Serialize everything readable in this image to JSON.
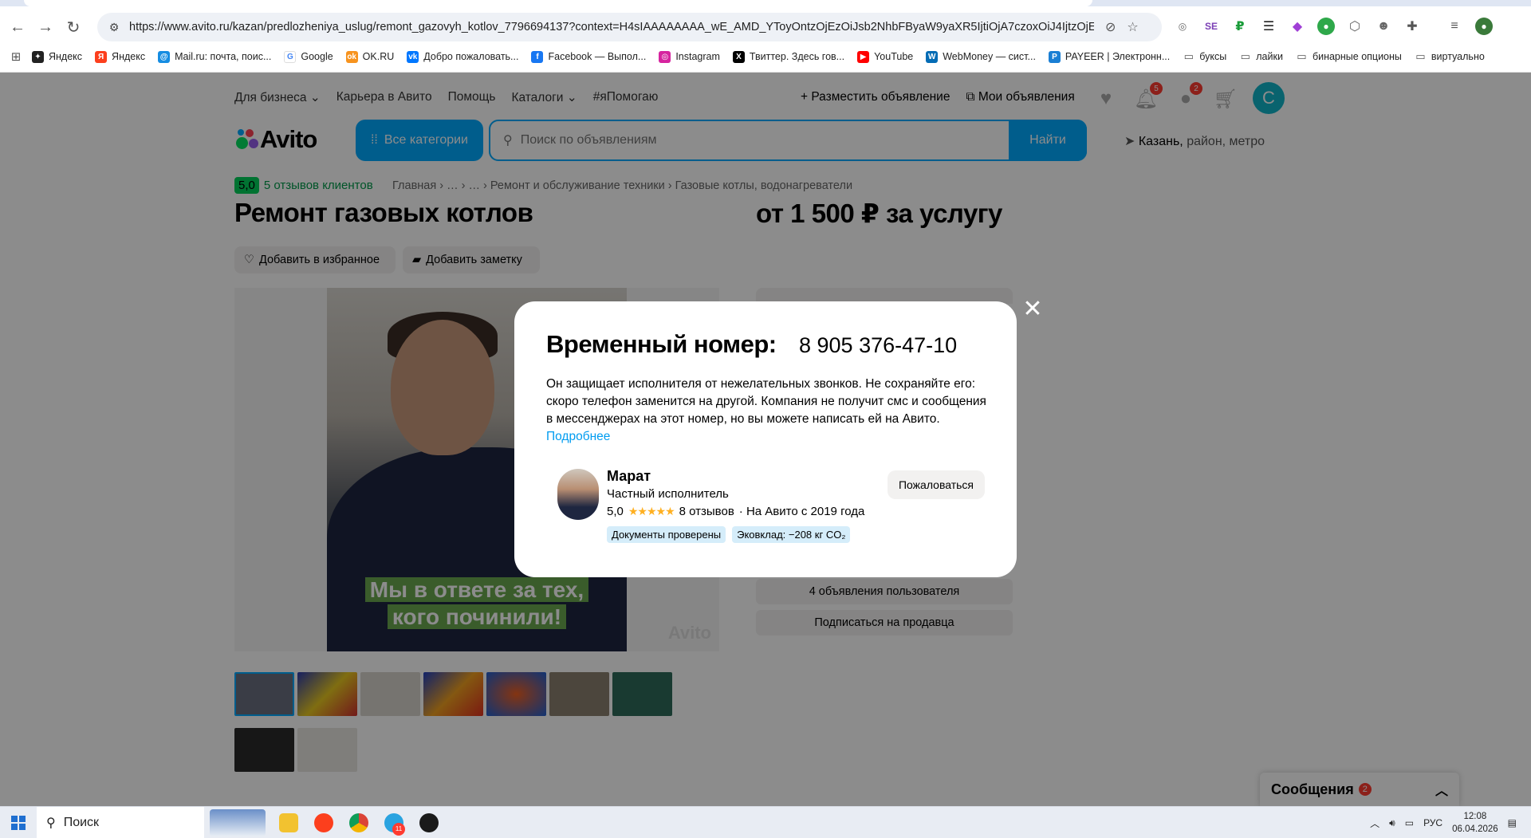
{
  "browser": {
    "url": "https://www.avito.ru/kazan/predlozheniya_uslug/remont_gazovyh_kotlov_7796694137?context=H4sIAAAAAAAA_wE_AMD_YToyOntzOjEzOiJsb2NhbFByaW9yaXR5IjtiOjA7czoxOiJ4IjtzOjE2OiJhM3pS...",
    "bookmarks": [
      "Яндекс",
      "Яндекс",
      "Mail.ru: почта, поис...",
      "Google",
      "OK.RU",
      "Добро пожаловать...",
      "Facebook — Выпол...",
      "Instagram",
      "Твиттер. Здесь гов...",
      "YouTube",
      "WebMoney — сист...",
      "PAYEER | Электронн...",
      "буксы",
      "лайки",
      "бинарные опционы",
      "виртуально"
    ]
  },
  "header": {
    "nav_left": [
      "Для бизнеса",
      "Карьера в Авито",
      "Помощь",
      "Каталоги",
      "#яПомогаю"
    ],
    "post_ad": "Разместить объявление",
    "my_ads": "Мои объявления",
    "notif_count": "5",
    "msg_count": "2",
    "avatar_letter": "С",
    "logo": "Avito",
    "categories": "Все категории",
    "search_placeholder": "Поиск по объявлениям",
    "search_button": "Найти",
    "city": "Казань,",
    "city_rest": " район, метро"
  },
  "listing": {
    "score": "5,0",
    "reviews": "5 отзывов клиентов",
    "breadcrumbs": "Главная  ›  …  ›  …  ›  Ремонт и обслуживание техники  ›  Газовые котлы, водонагреватели",
    "title": "Ремонт газовых котлов",
    "price": "от 1 500 ₽ за услугу",
    "fav": "Добавить в избранное",
    "note": "Добавить заметку",
    "photo_caption_1": "Мы в ответе за тех,",
    "photo_caption_2": "кого починили!",
    "watermark": "Avito",
    "user_ads": "4 объявления пользователя",
    "subscribe": "Подписаться на продавца"
  },
  "modal": {
    "title": "Временный номер:",
    "number": "8 905 376-47-10",
    "text": "Он защищает исполнителя от нежелательных звонков. Не сохраняйте его: скоро телефон заменится на другой. Компания не получит смс и сообщения в мессенджерах на этот номер, но вы можете написать ей на Авито.",
    "more": "Подробнее",
    "seller_name": "Марат",
    "seller_role": "Частный исполнитель",
    "seller_rating": "5,0",
    "stars": "★★★★★",
    "seller_reviews": "8 отзывов",
    "seller_since": "· На Авито с 2019 года",
    "tag1": "Документы проверены",
    "tag2": "Эковклад: −208 кг CO₂",
    "report": "Пожаловаться"
  },
  "messages": {
    "label": "Сообщения",
    "count": "2"
  },
  "taskbar": {
    "search": "Поиск",
    "lang": "РУС",
    "time": "12:08",
    "date": "06.04.2026",
    "telegram_badge": "11"
  }
}
